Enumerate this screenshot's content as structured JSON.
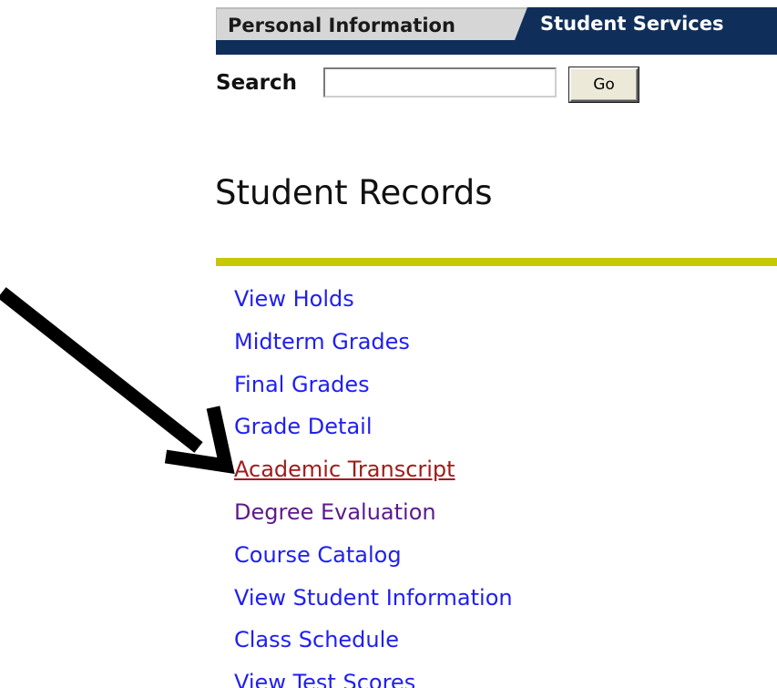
{
  "tabs": [
    {
      "label": "Personal Information",
      "active": false
    },
    {
      "label": "Student Services",
      "active": true
    }
  ],
  "search": {
    "label": "Search",
    "value": "",
    "placeholder": "",
    "button_label": "Go"
  },
  "page": {
    "title": "Student Records"
  },
  "links": [
    {
      "label": "View Holds",
      "state": "default"
    },
    {
      "label": "Midterm Grades",
      "state": "default"
    },
    {
      "label": "Final Grades",
      "state": "default"
    },
    {
      "label": "Grade Detail",
      "state": "default"
    },
    {
      "label": "Academic Transcript",
      "state": "hover"
    },
    {
      "label": "Degree Evaluation",
      "state": "visited"
    },
    {
      "label": "Course Catalog",
      "state": "default"
    },
    {
      "label": "View Student Information",
      "state": "default"
    },
    {
      "label": "Class Schedule",
      "state": "default"
    },
    {
      "label": "View Test Scores",
      "state": "default"
    }
  ],
  "colors": {
    "tab_active_bg": "#0f2f5a",
    "tab_inactive_bg": "#d6d6d6",
    "rule": "#c8c800",
    "link": "#1f1ff0",
    "link_hover": "#a01c1c",
    "link_visited": "#5d1a8c"
  },
  "annotation": {
    "icon": "arrow-pointer-icon",
    "points_to": "Academic Transcript"
  }
}
